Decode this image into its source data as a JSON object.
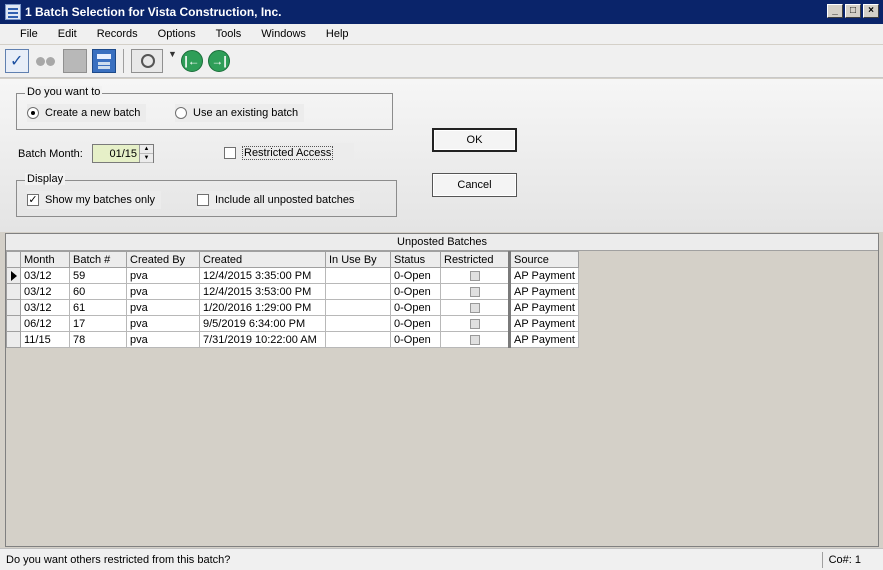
{
  "window": {
    "title": "1 Batch Selection for Vista Construction, Inc."
  },
  "menu": [
    "File",
    "Edit",
    "Records",
    "Options",
    "Tools",
    "Windows",
    "Help"
  ],
  "toolbar": {
    "icons": [
      "edit-icon",
      "find-icon",
      "package-icon",
      "calculator-icon",
      "print-preview-icon",
      "dropdown-caret-icon",
      "first-record-icon",
      "last-record-icon"
    ]
  },
  "batch_choice": {
    "legend": "Do you want to",
    "create_label": "Create a new batch",
    "existing_label": "Use an existing batch",
    "selected": "create"
  },
  "batch_month": {
    "label": "Batch Month:",
    "value": "01/15"
  },
  "restricted": {
    "label": "Restricted Access",
    "checked": false
  },
  "display": {
    "legend": "Display",
    "mine_label": "Show my batches only",
    "mine_checked": true,
    "all_label": "Include all unposted batches",
    "all_checked": false
  },
  "buttons": {
    "ok": "OK",
    "cancel": "Cancel"
  },
  "grid": {
    "caption": "Unposted Batches",
    "columns": [
      "Month",
      "Batch #",
      "Created By",
      "Created",
      "In Use By",
      "Status",
      "Restricted",
      "Source"
    ],
    "rows": [
      [
        "03/12",
        "59",
        "pva",
        "12/4/2015 3:35:00 PM",
        "",
        "0-Open",
        "",
        "AP Payment"
      ],
      [
        "03/12",
        "60",
        "pva",
        "12/4/2015 3:53:00 PM",
        "",
        "0-Open",
        "",
        "AP Payment"
      ],
      [
        "03/12",
        "61",
        "pva",
        "1/20/2016 1:29:00 PM",
        "",
        "0-Open",
        "",
        "AP Payment"
      ],
      [
        "06/12",
        "17",
        "pva",
        "9/5/2019 6:34:00 PM",
        "",
        "0-Open",
        "",
        "AP Payment"
      ],
      [
        "11/15",
        "78",
        "pva",
        "7/31/2019 10:22:00 AM",
        "",
        "0-Open",
        "",
        "AP Payment"
      ]
    ]
  },
  "status": {
    "message": "Do you want others restricted from this batch?",
    "company": "Co#: 1"
  },
  "colors": {
    "titlebar": "#0a246a",
    "month_field": "#e6f0c8",
    "nav_icon": "#2e9e58"
  }
}
